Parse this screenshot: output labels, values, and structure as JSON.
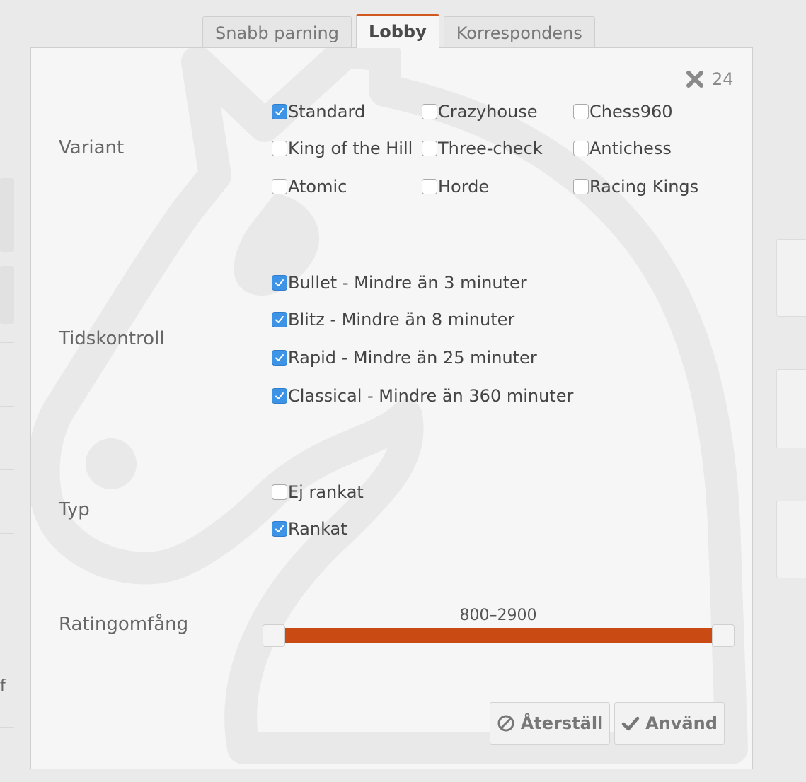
{
  "tabs": [
    "Snabb parning",
    "Lobby",
    "Korrespondens"
  ],
  "active_tab": "Lobby",
  "count": "24",
  "sections": {
    "variant": "Variant",
    "time_control": "Tidskontroll",
    "type": "Typ",
    "rating_range": "Ratingomfång"
  },
  "variants": [
    {
      "label": "Standard",
      "checked": true
    },
    {
      "label": "Crazyhouse",
      "checked": false
    },
    {
      "label": "Chess960",
      "checked": false
    },
    {
      "label": "King of the Hill",
      "checked": false
    },
    {
      "label": "Three-check",
      "checked": false
    },
    {
      "label": "Antichess",
      "checked": false
    },
    {
      "label": "Atomic",
      "checked": false
    },
    {
      "label": "Horde",
      "checked": false
    },
    {
      "label": "Racing Kings",
      "checked": false
    }
  ],
  "time_controls": [
    {
      "label": "Bullet - Mindre än 3 minuter",
      "checked": true
    },
    {
      "label": "Blitz - Mindre än 8 minuter",
      "checked": true
    },
    {
      "label": "Rapid - Mindre än 25 minuter",
      "checked": true
    },
    {
      "label": "Classical - Mindre än 360 minuter",
      "checked": true
    }
  ],
  "types": [
    {
      "label": "Ej rankat",
      "checked": false
    },
    {
      "label": "Rankat",
      "checked": true
    }
  ],
  "rating": {
    "value": "800–2900",
    "min": 800,
    "max": 2900
  },
  "buttons": {
    "reset": "Återställ",
    "apply": "Använd"
  },
  "colors": {
    "accent": "#d1581e",
    "slider": "#c94a13",
    "checkbox": "#3d93e6"
  }
}
